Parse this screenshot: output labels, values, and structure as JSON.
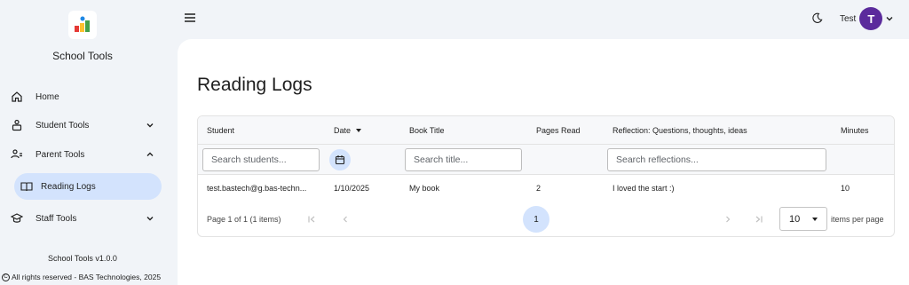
{
  "sidebar": {
    "app_name": "School Tools",
    "items": [
      {
        "label": "Home",
        "icon": "home-icon"
      },
      {
        "label": "Student Tools",
        "icon": "student-icon"
      },
      {
        "label": "Parent Tools",
        "icon": "parent-icon"
      },
      {
        "label": "Reading Logs",
        "icon": "book-icon"
      },
      {
        "label": "Staff Tools",
        "icon": "school-icon"
      }
    ],
    "version": "School Tools v1.0.0",
    "copyright": "All rights reserved - BAS Technologies, 2025"
  },
  "topbar": {
    "user_name": "Test",
    "avatar_initial": "T",
    "avatar_color": "#5b2b9c"
  },
  "page": {
    "title": "Reading Logs"
  },
  "table": {
    "columns": [
      "Student",
      "Date",
      "Book Title",
      "Pages Read",
      "Reflection: Questions, thoughts, ideas",
      "Minutes"
    ],
    "filters": {
      "student": "Search students...",
      "title": "Search title...",
      "reflection": "Search reflections..."
    },
    "rows": [
      {
        "student": "test.bastech@g.bas-techn...",
        "date": "1/10/2025",
        "title": "My book",
        "pages": "2",
        "reflection": "I loved the start :)",
        "minutes": "10"
      }
    ]
  },
  "pager": {
    "info": "Page 1 of 1 (1 items)",
    "current_page": "1",
    "page_size": "10",
    "page_size_label": "items per page"
  },
  "colors": {
    "accent_light": "#d3e3fd",
    "background": "#f1f4f8"
  }
}
